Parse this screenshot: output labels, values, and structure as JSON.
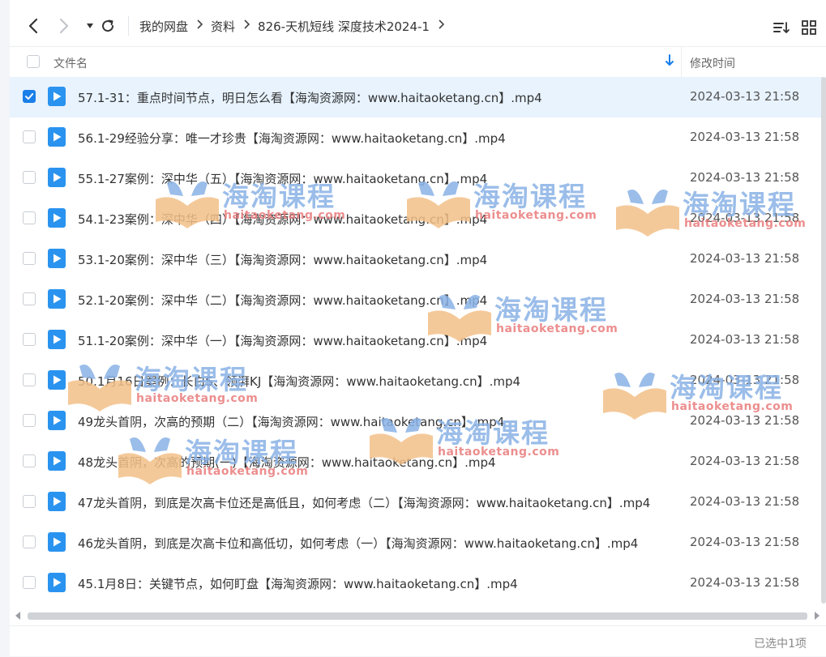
{
  "toolbar": {
    "breadcrumb": [
      "我的网盘",
      "资料",
      "826-天机短线 深度技术2024-1"
    ]
  },
  "header": {
    "name_label": "文件名",
    "time_label": "修改时间"
  },
  "files": [
    {
      "name": "57.1-31：重点时间节点，明日怎么看【海淘资源网：www.haitaoketang.cn】.mp4",
      "time": "2024-03-13 21:58",
      "selected": true
    },
    {
      "name": "56.1-29经验分享：唯一才珍贵【海淘资源网：www.haitaoketang.cn】.mp4",
      "time": "2024-03-13 21:58",
      "selected": false
    },
    {
      "name": "55.1-27案例：深中华（五）【海淘资源网：www.haitaoketang.cn】.mp4",
      "time": "2024-03-13 21:58",
      "selected": false
    },
    {
      "name": "54.1-23案例：深中华（四）【海淘资源网：www.haitaoketang.cn】.mp4",
      "time": "2024-03-13 21:58",
      "selected": false
    },
    {
      "name": "53.1-20案例：深中华（三）【海淘资源网：www.haitaoketang.cn】.mp4",
      "time": "2024-03-13 21:58",
      "selected": false
    },
    {
      "name": "52.1-20案例：深中华（二）【海淘资源网：www.haitaoketang.cn】.mp4",
      "time": "2024-03-13 21:58",
      "selected": false
    },
    {
      "name": "51.1-20案例：深中华（一）【海淘资源网：www.haitaoketang.cn】.mp4",
      "time": "2024-03-13 21:58",
      "selected": false
    },
    {
      "name": "50.1月16日案例：长白S、领湃KJ【海淘资源网：www.haitaoketang.cn】.mp4",
      "time": "2024-03-13 21:58",
      "selected": false
    },
    {
      "name": "49龙头首阴，次高的预期（二）【海淘资源网：www.haitaoketang.cn】.mp4",
      "time": "2024-03-13 21:58",
      "selected": false
    },
    {
      "name": "48龙头首阴，次高的预期(一)【海淘资源网：www.haitaoketang.cn】.mp4",
      "time": "2024-03-13 21:58",
      "selected": false
    },
    {
      "name": "47龙头首阴，到底是次高卡位还是高低且，如何考虑（二）【海淘资源网：www.haitaoketang.cn】.mp4",
      "time": "2024-03-13 21:58",
      "selected": false
    },
    {
      "name": "46龙头首阴，到底是次高卡位和高低切，如何考虑（一）【海淘资源网：www.haitaoketang.cn】.mp4",
      "time": "2024-03-13 21:58",
      "selected": false
    },
    {
      "name": "45.1月8日：关键节点，如何盯盘【海淘资源网：www.haitaoketang.cn】.mp4",
      "time": "2024-03-13 21:58",
      "selected": false
    }
  ],
  "status": {
    "selection_text": "已选中1项"
  },
  "watermark": {
    "title": "海淘课程",
    "url": "haitaoketang.com"
  },
  "colors": {
    "accent": "#1a7fe8",
    "file_icon": "#2a93ef",
    "selected_row": "#e8f3fe"
  }
}
